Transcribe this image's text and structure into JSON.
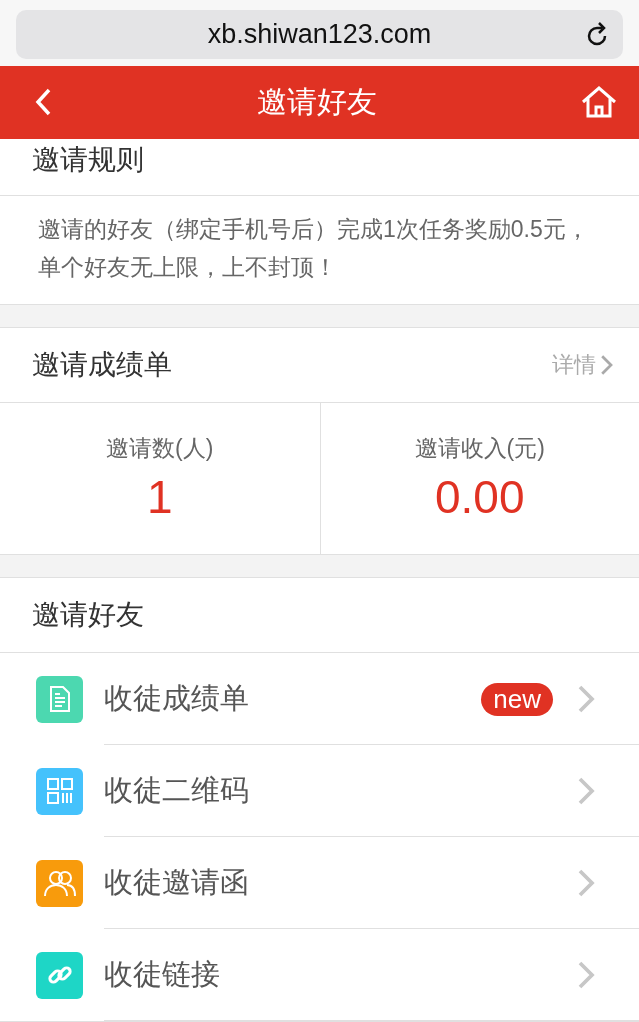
{
  "browser": {
    "url": "xb.shiwan123.com"
  },
  "header": {
    "title": "邀请好友"
  },
  "rules": {
    "title": "邀请规则",
    "text": "邀请的好友（绑定手机号后）完成1次任务奖励0.5元，单个好友无上限，上不封顶！"
  },
  "scorecard": {
    "title": "邀请成绩单",
    "link": "详情",
    "stats": [
      {
        "label": "邀请数(人)",
        "value": "1"
      },
      {
        "label": "邀请收入(元)",
        "value": "0.00"
      }
    ]
  },
  "invite": {
    "title": "邀请好友",
    "items": [
      {
        "kind": "document",
        "color": "#4cd8b0",
        "label": "收徒成绩单",
        "badge": "new"
      },
      {
        "kind": "qrcode",
        "color": "#45c2fc",
        "label": "收徒二维码"
      },
      {
        "kind": "people",
        "color": "#f89b0c",
        "label": "收徒邀请函"
      },
      {
        "kind": "link",
        "color": "#1ed6c6",
        "label": "收徒链接"
      }
    ]
  }
}
